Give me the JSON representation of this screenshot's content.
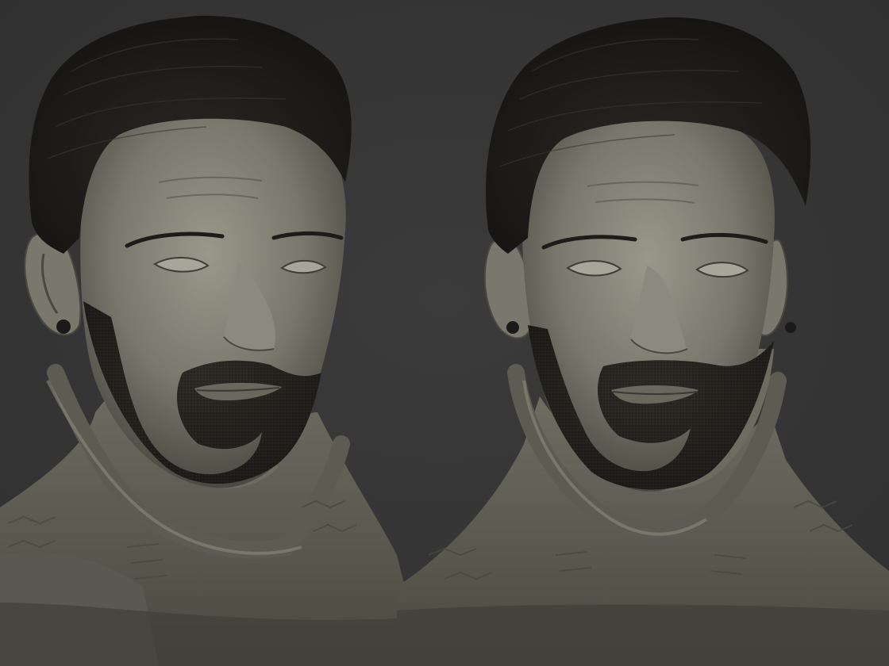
{
  "viewport": {
    "background_color": "#353535",
    "renders": [
      {
        "name": "bust-render-three-quarter",
        "view": "three-quarter"
      },
      {
        "name": "bust-render-front",
        "view": "front"
      }
    ]
  },
  "palette": {
    "clay_light": "#8a887c",
    "clay_mid": "#6f6d62",
    "clay_dark": "#3e3d37",
    "hair": "#1c1a17",
    "beard": "#25221e",
    "earring": "#1a1a1a"
  }
}
